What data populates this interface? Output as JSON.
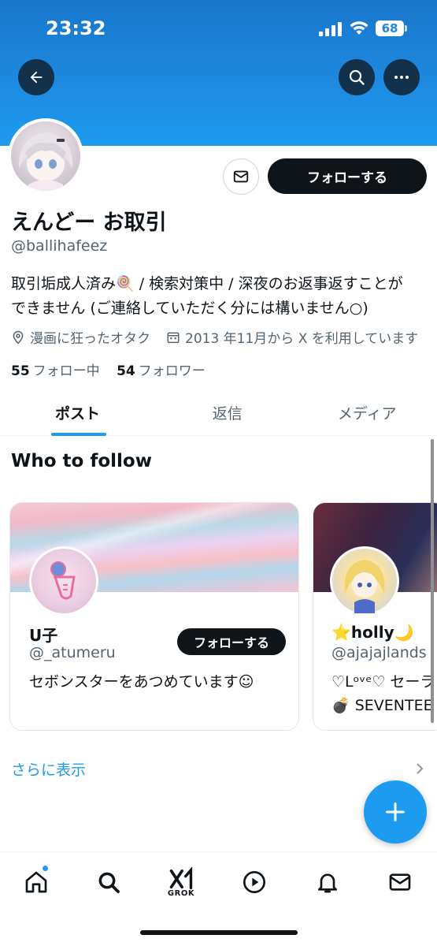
{
  "status_bar": {
    "time": "23:32",
    "battery": "68"
  },
  "profile": {
    "name": "えんどー お取引",
    "handle": "@ballihafeez",
    "bio_line1": "取引垢成人済み🍭 / 検索対策中 / 深夜のお返事返すことが",
    "bio_line2": "できません (ご連絡していただく分には構いません○)",
    "location": "漫画に狂ったオタク",
    "joined": "2013 年11月から X を利用しています",
    "following_count": "55",
    "following_label": "フォロー中",
    "followers_count": "54",
    "followers_label": "フォロワー",
    "follow_button": "フォローする"
  },
  "tabs": [
    {
      "label": "ポスト",
      "active": true
    },
    {
      "label": "返信",
      "active": false
    },
    {
      "label": "メディア",
      "active": false
    }
  ],
  "who_to_follow": {
    "title": "Who to follow",
    "cards": [
      {
        "name": "U子",
        "handle": "@_atumeru",
        "description": "セボンスターをあつめています☺",
        "follow_label": "フォローする"
      },
      {
        "name": "⭐holly🌙",
        "handle": "@ajajajlands",
        "description_line1": "♡Lᵒᵛᵉ♡ セーラ",
        "description_line2": "💣 SEVENTEE"
      }
    ],
    "show_more": "さらに表示"
  },
  "bottom_nav": {
    "grok_label": "GROK"
  },
  "colors": {
    "accent": "#1d9bf0",
    "text": "#0f1419",
    "secondary": "#536471",
    "banner": "#1d8be0"
  }
}
